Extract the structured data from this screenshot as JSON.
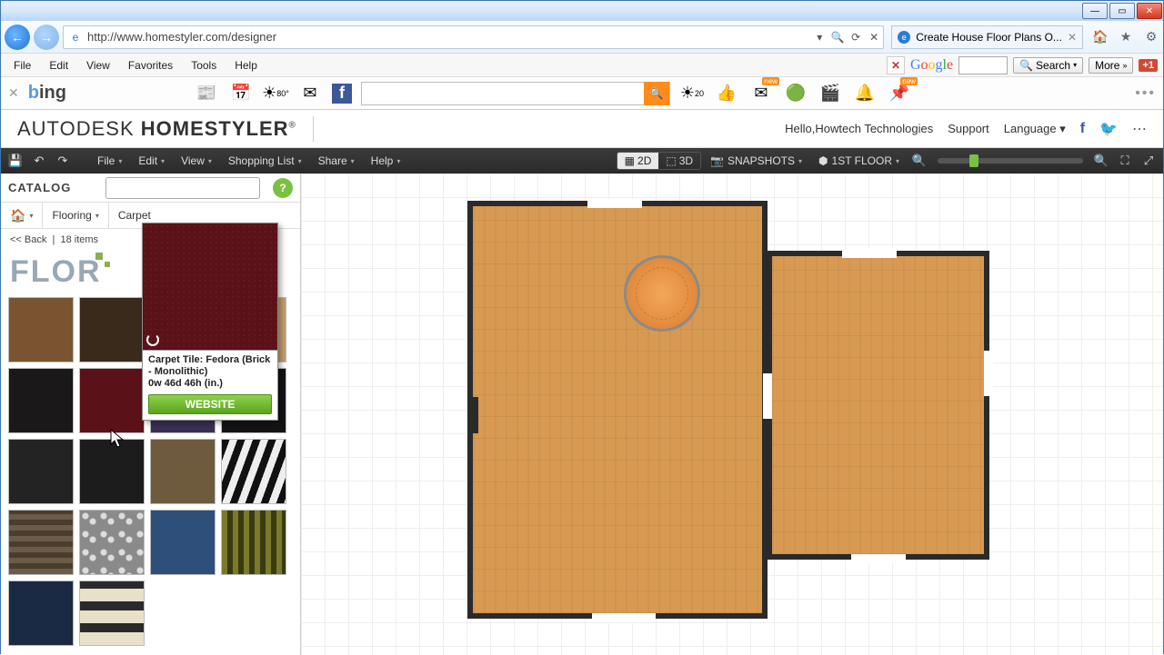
{
  "browser": {
    "url": "http://www.homestyler.com/designer",
    "tab_title": "Create House Floor Plans O...",
    "menus": [
      "File",
      "Edit",
      "View",
      "Favorites",
      "Tools",
      "Help"
    ],
    "search_label": "Search",
    "more_label": "More",
    "gplus": "+1",
    "weather": "80°",
    "badge_new": "new",
    "badge_20": "20"
  },
  "app": {
    "brand_a": "AUTODESK",
    "brand_b": "HOMESTYLER",
    "greeting": "Hello,Howtech Technologies",
    "support": "Support",
    "language": "Language",
    "menus": {
      "file": "File",
      "edit": "Edit",
      "view": "View",
      "shopping": "Shopping List",
      "share": "Share",
      "help": "Help"
    },
    "view2d": "2D",
    "view3d": "3D",
    "snapshots": "SNAPSHOTS",
    "floor": "1ST FLOOR"
  },
  "catalog": {
    "title": "CATALOG",
    "crumb_flooring": "Flooring",
    "crumb_carpet": "Carpet",
    "back": "<< Back",
    "count": "18 items",
    "brand": "FLOR",
    "swatches": [
      "#7a5430",
      "#3a2a1c",
      "#5a1218",
      "#c4a070",
      "#1a1818",
      "#5a1218",
      "#3a2f55",
      "#141414",
      "#232323",
      "#1c1c1c",
      "#6e5b3e",
      "zebra",
      "plaid",
      "floral",
      "#2d4f7a",
      "olive-stripe",
      "#1a2a44",
      "cream-stripe"
    ],
    "tooltip": {
      "title": "Carpet Tile: Fedora (Brick - Monolithic)",
      "dims": "0w 46d 46h (in.)",
      "button": "WEBSITE"
    }
  },
  "chart_data": null
}
